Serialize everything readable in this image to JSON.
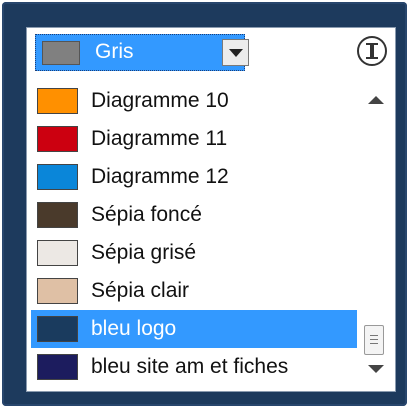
{
  "combo": {
    "selected_label": "Gris",
    "selected_color": "#808080"
  },
  "list": {
    "items": [
      {
        "label": "Diagramme 10",
        "color": "#ff9000"
      },
      {
        "label": "Diagramme 11",
        "color": "#cc0010"
      },
      {
        "label": "Diagramme 12",
        "color": "#0a86d9"
      },
      {
        "label": "Sépia foncé",
        "color": "#4a3a2b"
      },
      {
        "label": "Sépia grisé",
        "color": "#ece8e4"
      },
      {
        "label": "Sépia clair",
        "color": "#dfc0a5"
      },
      {
        "label": "bleu logo",
        "color": "#1a3b5e"
      },
      {
        "label": "bleu site am et fiches",
        "color": "#1c1c5e"
      }
    ],
    "selected_index": 6
  },
  "colors": {
    "frame": "#1d3a5d",
    "highlight": "#3399ff"
  },
  "icons": {
    "dropdown": "chevron-down-icon",
    "info": "info-icon",
    "scroll_up": "scroll-up-arrow-icon",
    "scroll_down": "scroll-down-arrow-icon"
  }
}
